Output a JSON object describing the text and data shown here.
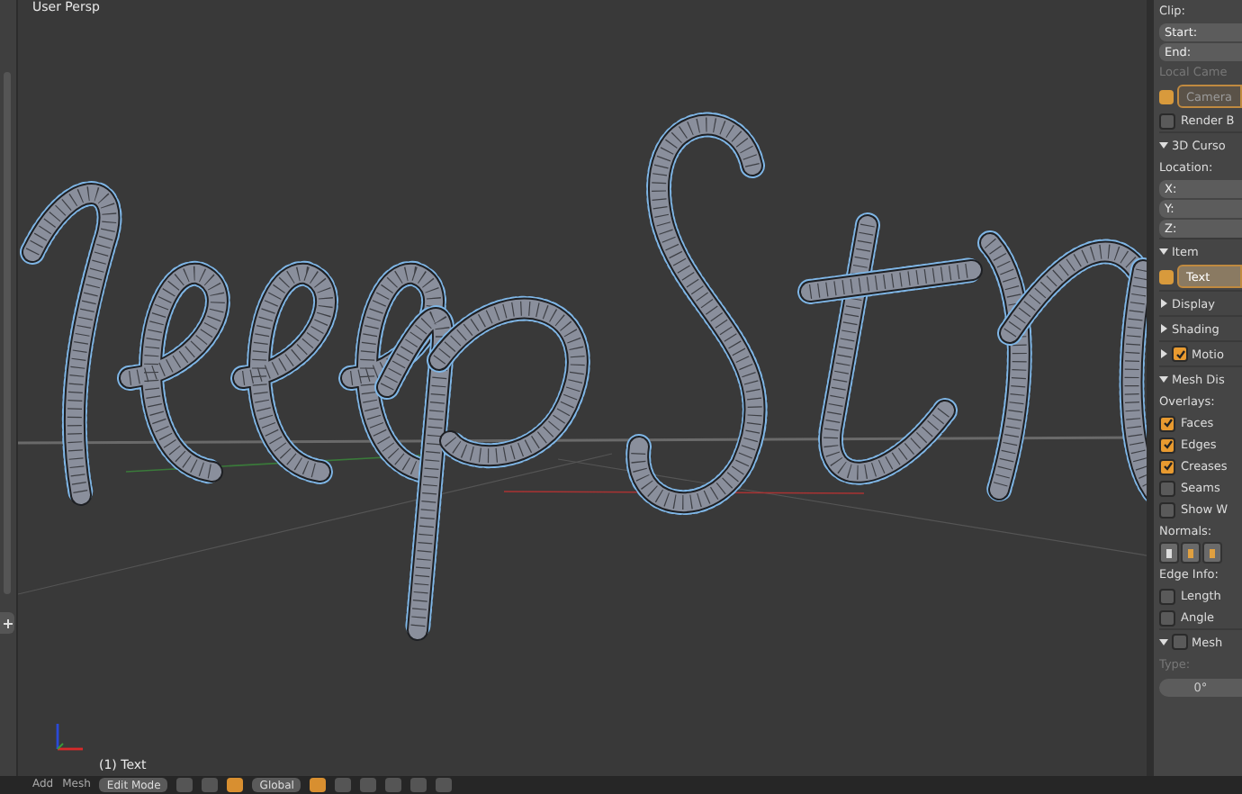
{
  "viewport": {
    "title": "User Persp",
    "object_label": "(1) Text"
  },
  "properties": [
    {
      "kind": "label",
      "label": "Clip:"
    },
    {
      "kind": "field",
      "label": "Start:"
    },
    {
      "kind": "field",
      "label": "End:"
    },
    {
      "kind": "label",
      "label": "Local Came",
      "disabled": true
    },
    {
      "kind": "button",
      "label": "Camera",
      "disabled": true
    },
    {
      "kind": "checkbox",
      "label": "Render B",
      "checked": false
    },
    {
      "kind": "header",
      "label": "3D Curso",
      "expanded": true
    },
    {
      "kind": "label",
      "label": "Location:"
    },
    {
      "kind": "field",
      "label": "X:"
    },
    {
      "kind": "field",
      "label": "Y:"
    },
    {
      "kind": "field",
      "label": "Z:"
    },
    {
      "kind": "header",
      "label": "Item",
      "expanded": true
    },
    {
      "kind": "button",
      "label": "Text",
      "disabled": false
    },
    {
      "kind": "header",
      "label": "Display",
      "expanded": false
    },
    {
      "kind": "header",
      "label": "Shading",
      "expanded": false
    },
    {
      "kind": "header",
      "label": "Motio",
      "expanded": false,
      "checked": true
    },
    {
      "kind": "header",
      "label": "Mesh Dis",
      "expanded": true
    },
    {
      "kind": "label",
      "label": "Overlays:"
    },
    {
      "kind": "checkbox",
      "label": "Faces",
      "checked": true
    },
    {
      "kind": "checkbox",
      "label": "Edges",
      "checked": true
    },
    {
      "kind": "checkbox",
      "label": "Creases",
      "checked": true
    },
    {
      "kind": "checkbox",
      "label": "Seams",
      "checked": false
    },
    {
      "kind": "checkbox",
      "label": "Show W",
      "checked": false
    },
    {
      "kind": "label",
      "label": "Normals:"
    },
    {
      "kind": "icons"
    },
    {
      "kind": "label",
      "label": "Edge Info:"
    },
    {
      "kind": "checkbox",
      "label": "Length",
      "checked": false
    },
    {
      "kind": "checkbox",
      "label": "Angle",
      "checked": false
    },
    {
      "kind": "header",
      "label": "Mesh",
      "expanded": true,
      "checked": false
    },
    {
      "kind": "label",
      "label": "Type:",
      "disabled": true
    },
    {
      "kind": "slider",
      "label": "0°"
    }
  ],
  "header_bar": {
    "menus": [
      "Add",
      "Mesh"
    ],
    "mode": "Edit Mode",
    "orientation": "Global"
  }
}
